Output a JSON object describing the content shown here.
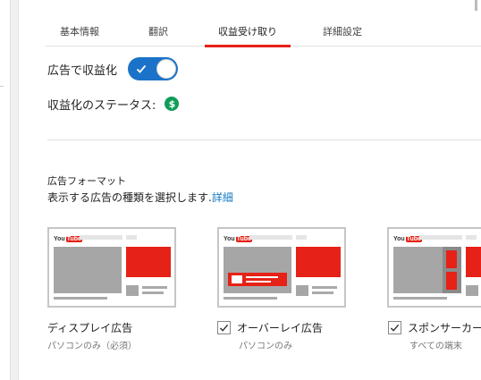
{
  "tabs": [
    {
      "label": "基本情報",
      "active": false
    },
    {
      "label": "翻訳",
      "active": false
    },
    {
      "label": "収益受け取り",
      "active": true
    },
    {
      "label": "詳細設定",
      "active": false
    }
  ],
  "monetize": {
    "label": "広告で収益化",
    "enabled": true
  },
  "status": {
    "label": "収益化のステータス:",
    "icon": "dollar-icon"
  },
  "ad_formats": {
    "title": "広告フォーマット",
    "description": "表示する広告の種類を選択します.",
    "details_link": "詳細",
    "items": [
      {
        "name": "ディスプレイ広告",
        "sub": "パソコンのみ（必須）",
        "checkbox": false
      },
      {
        "name": "オーバーレイ広告",
        "sub": "パソコンのみ",
        "checkbox": true,
        "checked": true
      },
      {
        "name": "スポンサーカード",
        "sub": "すべての端末",
        "checkbox": true,
        "checked": true
      }
    ]
  },
  "logo": {
    "you": "You",
    "tube": "Tube"
  },
  "colors": {
    "accent": "#e62117",
    "toggle": "#1a73c8",
    "link": "#167ac6",
    "status": "#0f9d58"
  }
}
